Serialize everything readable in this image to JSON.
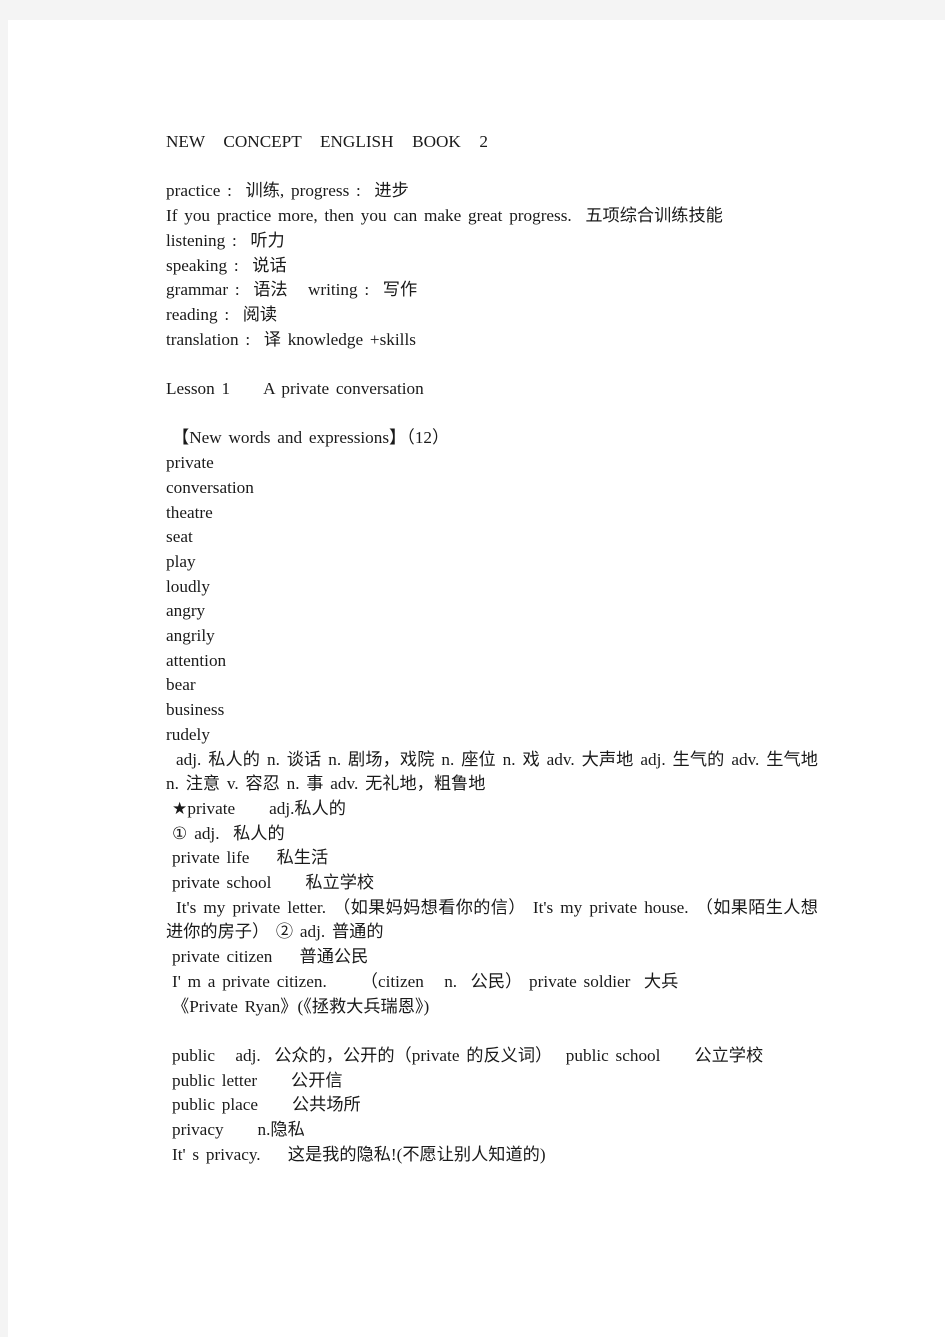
{
  "document": {
    "title": "NEW  CONCEPT  ENGLISH  BOOK  2",
    "intro": {
      "line1": "practice :  训练, progress :  进步",
      "line2": "If you practice more, then you can make great progress.  五项综合训练技能",
      "line3": "listening :  听力",
      "line4": "speaking :  说话",
      "line5": "grammar :  语法   writing :  写作",
      "line6": "reading :  阅读",
      "line7": "translation :  译 knowledge +skills"
    },
    "lesson": {
      "heading": "Lesson 1     A private conversation",
      "new_words_heading": "【New words and expressions】（12）",
      "words": [
        "private",
        "conversation",
        "theatre",
        "seat",
        "play",
        "loudly",
        "angry",
        "angrily",
        "attention",
        "bear",
        "business",
        "rudely"
      ],
      "definitions": "adj. 私人的 n. 谈话 n. 剧场，戏院 n. 座位 n. 戏 adv. 大声地 adj. 生气的 adv. 生气地 n. 注意 v. 容忍 n. 事 adv. 无礼地，粗鲁地"
    },
    "private_entry": {
      "headword": "★private     adj.私人的",
      "sense1": "① adj.  私人的",
      "collocation1": "private life    私生活",
      "collocation2": "private school     私立学校",
      "examples_block": "It's my private letter.   （如果妈妈想看你的信）   It's my private house.   （如果陌生人想进你的房子）   ② adj.  普通的",
      "collocation3": "private citizen    普通公民",
      "example2": "I' m a private citizen.     （citizen   n.  公民） private soldier  大兵",
      "example3": "《Private Ryan》(《拯救大兵瑞恩》)"
    },
    "public_entry": {
      "line1": "public   adj.  公众的，公开的（private 的反义词）  public school     公立学校",
      "line2": "public letter     公开信",
      "line3": "public place     公共场所",
      "line4": "privacy     n.隐私",
      "line5": "It' s privacy.    这是我的隐私!(不愿让别人知道的)"
    }
  },
  "colors": {
    "page_background": "#ffffff",
    "canvas_background": "#f4f4f4",
    "text": "#1a1a1a"
  }
}
